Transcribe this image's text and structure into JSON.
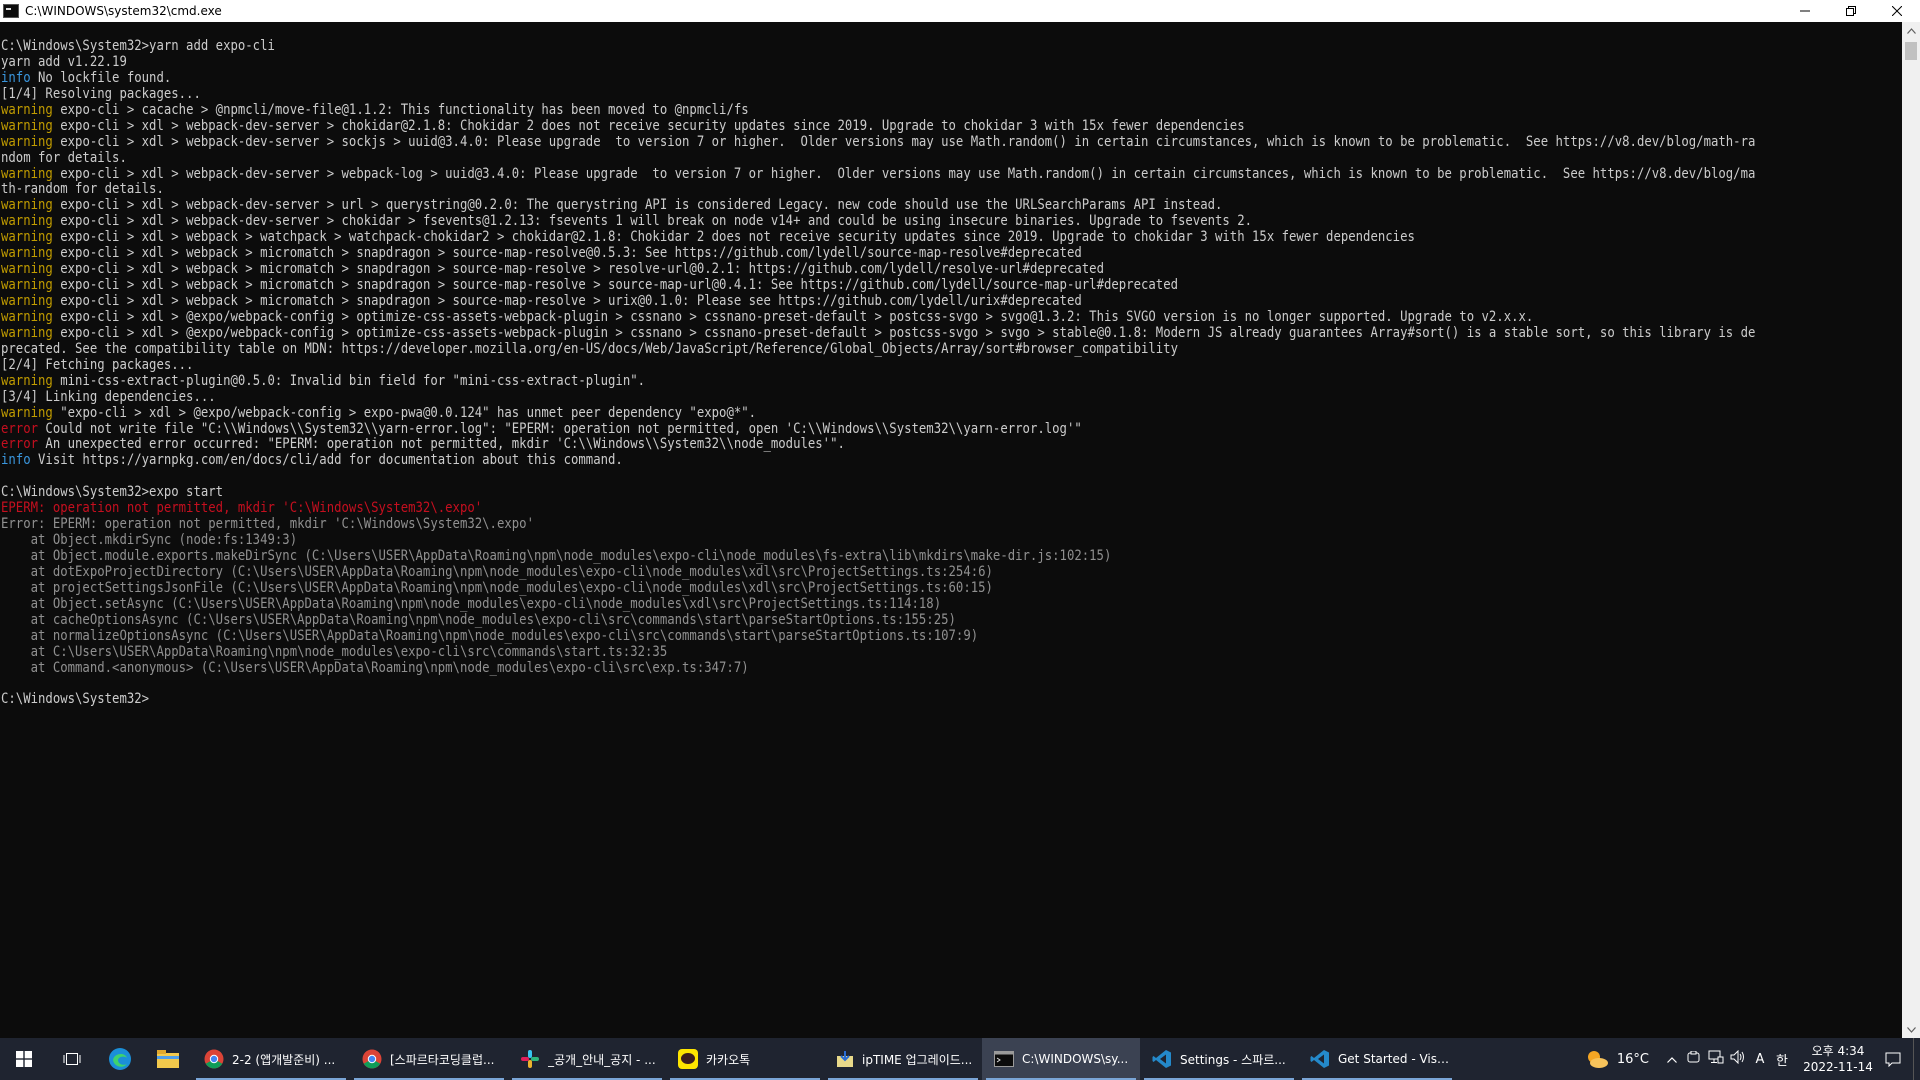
{
  "window": {
    "title": "C:\\WINDOWS\\system32\\cmd.exe",
    "minimize_icon": "minimize-icon",
    "restore_icon": "restore-icon",
    "close_icon": "close-icon"
  },
  "console": {
    "lines": [
      {
        "parts": [
          {
            "t": "C:\\Windows\\System32>yarn add expo-cli",
            "c": ""
          }
        ]
      },
      {
        "parts": [
          {
            "t": "yarn add v1.22.19",
            "c": ""
          }
        ]
      },
      {
        "parts": [
          {
            "t": "info",
            "c": "info"
          },
          {
            "t": " No lockfile found.",
            "c": ""
          }
        ]
      },
      {
        "parts": [
          {
            "t": "[1/4] Resolving packages...",
            "c": ""
          }
        ]
      },
      {
        "parts": [
          {
            "t": "warning",
            "c": "warn"
          },
          {
            "t": " expo-cli > cacache > @npmcli/move-file@1.1.2: This functionality has been moved to @npmcli/fs",
            "c": ""
          }
        ]
      },
      {
        "parts": [
          {
            "t": "warning",
            "c": "warn"
          },
          {
            "t": " expo-cli > xdl > webpack-dev-server > chokidar@2.1.8: Chokidar 2 does not receive security updates since 2019. Upgrade to chokidar 3 with 15x fewer dependencies",
            "c": ""
          }
        ]
      },
      {
        "parts": [
          {
            "t": "warning",
            "c": "warn"
          },
          {
            "t": " expo-cli > xdl > webpack-dev-server > sockjs > uuid@3.4.0: Please upgrade  to version 7 or higher.  Older versions may use Math.random() in certain circumstances, which is known to be problematic.  See https://v8.dev/blog/math-ra",
            "c": ""
          }
        ]
      },
      {
        "parts": [
          {
            "t": "ndom for details.",
            "c": ""
          }
        ]
      },
      {
        "parts": [
          {
            "t": "warning",
            "c": "warn"
          },
          {
            "t": " expo-cli > xdl > webpack-dev-server > webpack-log > uuid@3.4.0: Please upgrade  to version 7 or higher.  Older versions may use Math.random() in certain circumstances, which is known to be problematic.  See https://v8.dev/blog/ma",
            "c": ""
          }
        ]
      },
      {
        "parts": [
          {
            "t": "th-random for details.",
            "c": ""
          }
        ]
      },
      {
        "parts": [
          {
            "t": "warning",
            "c": "warn"
          },
          {
            "t": " expo-cli > xdl > webpack-dev-server > url > querystring@0.2.0: The querystring API is considered Legacy. new code should use the URLSearchParams API instead.",
            "c": ""
          }
        ]
      },
      {
        "parts": [
          {
            "t": "warning",
            "c": "warn"
          },
          {
            "t": " expo-cli > xdl > webpack-dev-server > chokidar > fsevents@1.2.13: fsevents 1 will break on node v14+ and could be using insecure binaries. Upgrade to fsevents 2.",
            "c": ""
          }
        ]
      },
      {
        "parts": [
          {
            "t": "warning",
            "c": "warn"
          },
          {
            "t": " expo-cli > xdl > webpack > watchpack > watchpack-chokidar2 > chokidar@2.1.8: Chokidar 2 does not receive security updates since 2019. Upgrade to chokidar 3 with 15x fewer dependencies",
            "c": ""
          }
        ]
      },
      {
        "parts": [
          {
            "t": "warning",
            "c": "warn"
          },
          {
            "t": " expo-cli > xdl > webpack > micromatch > snapdragon > source-map-resolve@0.5.3: See https://github.com/lydell/source-map-resolve#deprecated",
            "c": ""
          }
        ]
      },
      {
        "parts": [
          {
            "t": "warning",
            "c": "warn"
          },
          {
            "t": " expo-cli > xdl > webpack > micromatch > snapdragon > source-map-resolve > resolve-url@0.2.1: https://github.com/lydell/resolve-url#deprecated",
            "c": ""
          }
        ]
      },
      {
        "parts": [
          {
            "t": "warning",
            "c": "warn"
          },
          {
            "t": " expo-cli > xdl > webpack > micromatch > snapdragon > source-map-resolve > source-map-url@0.4.1: See https://github.com/lydell/source-map-url#deprecated",
            "c": ""
          }
        ]
      },
      {
        "parts": [
          {
            "t": "warning",
            "c": "warn"
          },
          {
            "t": " expo-cli > xdl > webpack > micromatch > snapdragon > source-map-resolve > urix@0.1.0: Please see https://github.com/lydell/urix#deprecated",
            "c": ""
          }
        ]
      },
      {
        "parts": [
          {
            "t": "warning",
            "c": "warn"
          },
          {
            "t": " expo-cli > xdl > @expo/webpack-config > optimize-css-assets-webpack-plugin > cssnano > cssnano-preset-default > postcss-svgo > svgo@1.3.2: This SVGO version is no longer supported. Upgrade to v2.x.x.",
            "c": ""
          }
        ]
      },
      {
        "parts": [
          {
            "t": "warning",
            "c": "warn"
          },
          {
            "t": " expo-cli > xdl > @expo/webpack-config > optimize-css-assets-webpack-plugin > cssnano > cssnano-preset-default > postcss-svgo > svgo > stable@0.1.8: Modern JS already guarantees Array#sort() is a stable sort, so this library is de",
            "c": ""
          }
        ]
      },
      {
        "parts": [
          {
            "t": "precated. See the compatibility table on MDN: https://developer.mozilla.org/en-US/docs/Web/JavaScript/Reference/Global_Objects/Array/sort#browser_compatibility",
            "c": ""
          }
        ]
      },
      {
        "parts": [
          {
            "t": "[2/4] Fetching packages...",
            "c": ""
          }
        ]
      },
      {
        "parts": [
          {
            "t": "warning",
            "c": "warn"
          },
          {
            "t": " mini-css-extract-plugin@0.5.0: Invalid bin field for \"mini-css-extract-plugin\".",
            "c": ""
          }
        ]
      },
      {
        "parts": [
          {
            "t": "[3/4] Linking dependencies...",
            "c": ""
          }
        ]
      },
      {
        "parts": [
          {
            "t": "warning",
            "c": "warn"
          },
          {
            "t": " \"expo-cli > xdl > @expo/webpack-config > expo-pwa@0.0.124\" has unmet peer dependency \"expo@*\".",
            "c": ""
          }
        ]
      },
      {
        "parts": [
          {
            "t": "error",
            "c": "err"
          },
          {
            "t": " Could not write file \"C:\\\\Windows\\\\System32\\\\yarn-error.log\": \"EPERM: operation not permitted, open 'C:\\\\Windows\\\\System32\\\\yarn-error.log'\"",
            "c": ""
          }
        ]
      },
      {
        "parts": [
          {
            "t": "error",
            "c": "err"
          },
          {
            "t": " An unexpected error occurred: \"EPERM: operation not permitted, mkdir 'C:\\\\Windows\\\\System32\\\\node_modules'\".",
            "c": ""
          }
        ]
      },
      {
        "parts": [
          {
            "t": "info",
            "c": "info"
          },
          {
            "t": " Visit https://yarnpkg.com/en/docs/cli/add for documentation about this command.",
            "c": ""
          }
        ]
      },
      {
        "parts": [
          {
            "t": "",
            "c": ""
          }
        ]
      },
      {
        "parts": [
          {
            "t": "C:\\Windows\\System32>expo start",
            "c": ""
          }
        ]
      },
      {
        "parts": [
          {
            "t": "EPERM: operation not permitted, mkdir 'C:\\Windows\\System32\\.expo'",
            "c": "red"
          }
        ]
      },
      {
        "parts": [
          {
            "t": "Error: EPERM: operation not permitted, mkdir 'C:\\Windows\\System32\\.expo'",
            "c": "dim"
          }
        ]
      },
      {
        "parts": [
          {
            "t": "    at Object.mkdirSync (node:fs:1349:3)",
            "c": "dim"
          }
        ]
      },
      {
        "parts": [
          {
            "t": "    at Object.module.exports.makeDirSync (C:\\Users\\USER\\AppData\\Roaming\\npm\\node_modules\\expo-cli\\node_modules\\fs-extra\\lib\\mkdirs\\make-dir.js:102:15)",
            "c": "dim"
          }
        ]
      },
      {
        "parts": [
          {
            "t": "    at dotExpoProjectDirectory (C:\\Users\\USER\\AppData\\Roaming\\npm\\node_modules\\expo-cli\\node_modules\\xdl\\src\\ProjectSettings.ts:254:6)",
            "c": "dim"
          }
        ]
      },
      {
        "parts": [
          {
            "t": "    at projectSettingsJsonFile (C:\\Users\\USER\\AppData\\Roaming\\npm\\node_modules\\expo-cli\\node_modules\\xdl\\src\\ProjectSettings.ts:60:15)",
            "c": "dim"
          }
        ]
      },
      {
        "parts": [
          {
            "t": "    at Object.setAsync (C:\\Users\\USER\\AppData\\Roaming\\npm\\node_modules\\expo-cli\\node_modules\\xdl\\src\\ProjectSettings.ts:114:18)",
            "c": "dim"
          }
        ]
      },
      {
        "parts": [
          {
            "t": "    at cacheOptionsAsync (C:\\Users\\USER\\AppData\\Roaming\\npm\\node_modules\\expo-cli\\src\\commands\\start\\parseStartOptions.ts:155:25)",
            "c": "dim"
          }
        ]
      },
      {
        "parts": [
          {
            "t": "    at normalizeOptionsAsync (C:\\Users\\USER\\AppData\\Roaming\\npm\\node_modules\\expo-cli\\src\\commands\\start\\parseStartOptions.ts:107:9)",
            "c": "dim"
          }
        ]
      },
      {
        "parts": [
          {
            "t": "    at C:\\Users\\USER\\AppData\\Roaming\\npm\\node_modules\\expo-cli\\src\\commands\\start.ts:32:35",
            "c": "dim"
          }
        ]
      },
      {
        "parts": [
          {
            "t": "    at Command.<anonymous> (C:\\Users\\USER\\AppData\\Roaming\\npm\\node_modules\\expo-cli\\src\\exp.ts:347:7)",
            "c": "dim"
          }
        ]
      },
      {
        "parts": [
          {
            "t": "",
            "c": ""
          }
        ]
      },
      {
        "parts": [
          {
            "t": "C:\\Windows\\System32>",
            "c": ""
          }
        ]
      }
    ],
    "colors": {
      "background": "#0c0c0c",
      "text": "#cccccc",
      "info": "#3a96dd",
      "warning": "#c19c00",
      "error": "#c50f1f"
    }
  },
  "taskbar": {
    "start_icon": "windows-start-icon",
    "task_view_icon": "task-view-icon",
    "edge_icon": "edge-icon",
    "explorer_icon": "file-explorer-icon",
    "apps": [
      {
        "label": "2-2 (앱개발준비) ...",
        "icon": "chrome-icon"
      },
      {
        "label": "[스파르타코딩클럽...",
        "icon": "chrome-icon"
      },
      {
        "label": "_공개_안내_공지 - ...",
        "icon": "slack-icon"
      },
      {
        "label": "카카오톡",
        "icon": "kakaotalk-icon"
      },
      {
        "label": "ipTIME 업그레이드...",
        "icon": "iptime-icon"
      },
      {
        "label": "C:\\WINDOWS\\sy...",
        "icon": "cmd-icon"
      },
      {
        "label": "Settings - 스파르...",
        "icon": "vscode-icon"
      },
      {
        "label": "Get Started - Visua...",
        "icon": "vscode-icon"
      }
    ],
    "weather": {
      "temp": "16°C",
      "icon": "weather-cloud-sun-icon"
    },
    "tray_ime_a": "A",
    "tray_ime_han": "한",
    "clock_time": "오후 4:34",
    "clock_date": "2022-11-14"
  }
}
